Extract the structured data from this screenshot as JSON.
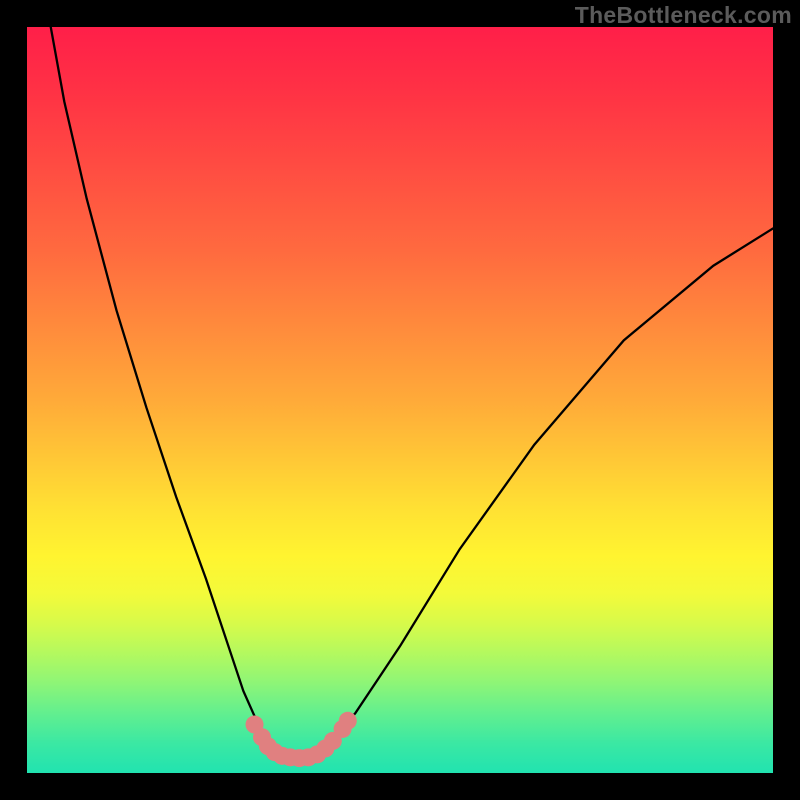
{
  "watermark": "TheBottleneck.com",
  "colors": {
    "frame": "#000000",
    "gradient_top": "#ff1f49",
    "gradient_bottom": "#21e3b0",
    "curve": "#000000",
    "dots_fill": "#e08080",
    "dots_stroke": "#b55a5a"
  },
  "chart_data": {
    "type": "line",
    "title": "",
    "xlabel": "",
    "ylabel": "",
    "xlim": [
      0,
      100
    ],
    "ylim": [
      0,
      100
    ],
    "series": [
      {
        "name": "bottleneck-curve",
        "x": [
          3,
          5,
          8,
          12,
          16,
          20,
          24,
          27,
          29,
          31,
          33,
          34.5,
          36,
          38,
          40,
          44,
          50,
          58,
          68,
          80,
          92,
          100
        ],
        "y": [
          101,
          90,
          77,
          62,
          49,
          37,
          26,
          17,
          11,
          6.5,
          3.5,
          2.3,
          2,
          2.2,
          3.5,
          8,
          17,
          30,
          44,
          58,
          68,
          73
        ]
      }
    ],
    "annotations": [
      {
        "name": "cluster-dot",
        "x": 30.5,
        "y": 6.5
      },
      {
        "name": "cluster-dot",
        "x": 31.5,
        "y": 4.8
      },
      {
        "name": "cluster-dot",
        "x": 32.3,
        "y": 3.6
      },
      {
        "name": "cluster-dot",
        "x": 33.2,
        "y": 2.8
      },
      {
        "name": "cluster-dot",
        "x": 34.2,
        "y": 2.3
      },
      {
        "name": "cluster-dot",
        "x": 35.3,
        "y": 2.1
      },
      {
        "name": "cluster-dot",
        "x": 36.5,
        "y": 2.0
      },
      {
        "name": "cluster-dot",
        "x": 37.7,
        "y": 2.1
      },
      {
        "name": "cluster-dot",
        "x": 38.9,
        "y": 2.5
      },
      {
        "name": "cluster-dot",
        "x": 40.0,
        "y": 3.3
      },
      {
        "name": "cluster-dot",
        "x": 41.0,
        "y": 4.3
      },
      {
        "name": "cluster-dot",
        "x": 42.3,
        "y": 5.9
      },
      {
        "name": "cluster-dot",
        "x": 43.0,
        "y": 7.0
      }
    ]
  }
}
